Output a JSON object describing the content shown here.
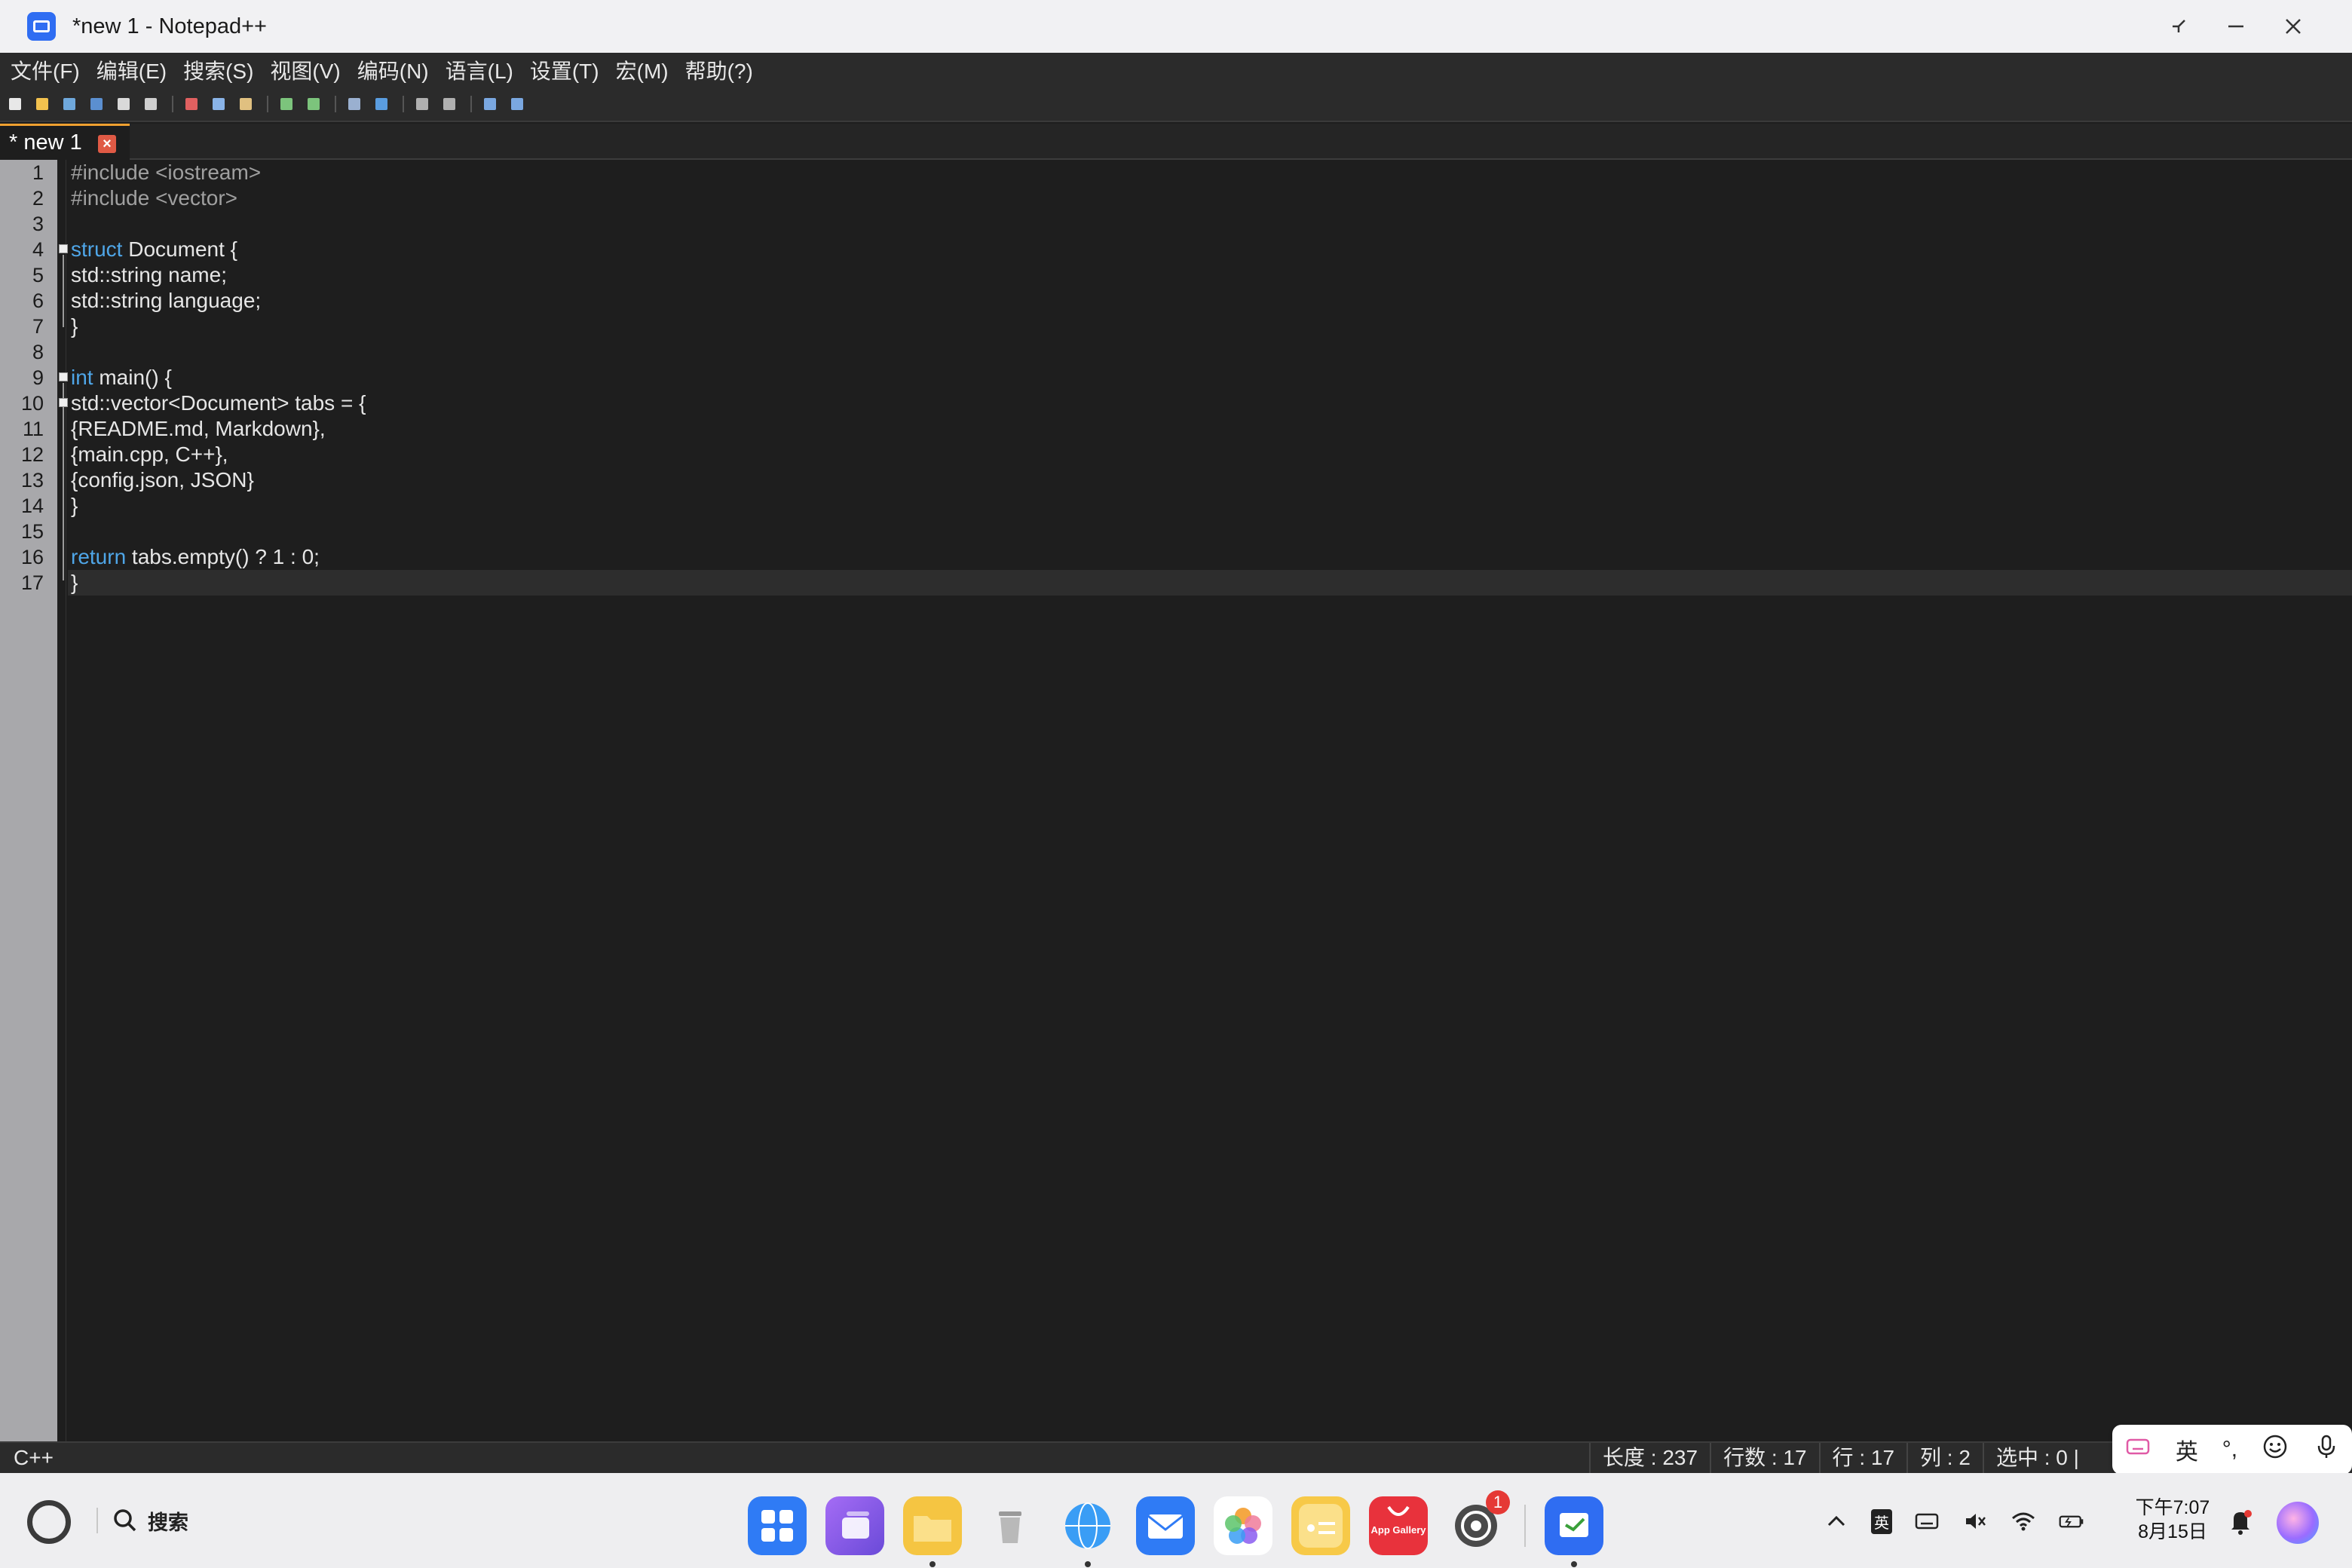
{
  "window": {
    "title": "*new 1 - Notepad++",
    "controls": [
      "restore-icon",
      "minimize-icon",
      "close-icon"
    ]
  },
  "menu": {
    "items": [
      "文件(F)",
      "编辑(E)",
      "搜索(S)",
      "视图(V)",
      "编码(N)",
      "语言(L)",
      "设置(T)",
      "宏(M)",
      "帮助(?)"
    ]
  },
  "toolbar": {
    "buttons": [
      "new-file-icon",
      "open-file-icon",
      "save-icon",
      "save-all-icon",
      "close-icon",
      "close-all-icon",
      "print-icon",
      "cut-icon",
      "copy-icon",
      "paste-icon",
      "undo-icon",
      "redo-icon",
      "find-icon",
      "replace-icon",
      "zoom-in-icon",
      "zoom-out-icon",
      "wrap-icon",
      "show-all-chars-icon"
    ]
  },
  "tabs": [
    {
      "label": "* new 1",
      "active": true
    }
  ],
  "editor": {
    "lines": [
      {
        "num": "1",
        "text": "#include <iostream>"
      },
      {
        "num": "2",
        "text": "#include <vector>"
      },
      {
        "num": "3",
        "text": ""
      },
      {
        "num": "4",
        "text": "struct Document {"
      },
      {
        "num": "5",
        "text": "std::string name;"
      },
      {
        "num": "6",
        "text": "std::string language;"
      },
      {
        "num": "7",
        "text": "}"
      },
      {
        "num": "8",
        "text": ""
      },
      {
        "num": "9",
        "text": "int main() {"
      },
      {
        "num": "10",
        "text": "std::vector<Document> tabs = {"
      },
      {
        "num": "11",
        "text": "{README.md, Markdown},"
      },
      {
        "num": "12",
        "text": "{main.cpp, C++},"
      },
      {
        "num": "13",
        "text": "{config.json, JSON}"
      },
      {
        "num": "14",
        "text": "}"
      },
      {
        "num": "15",
        "text": ""
      },
      {
        "num": "16",
        "text": "return tabs.empty() ? 1 : 0;"
      },
      {
        "num": "17",
        "text": "}"
      }
    ],
    "current_line": "17",
    "colors": {
      "keyword": "#4fa6e8",
      "preprocessor": "#a0a0a0",
      "text": "#e6e6e6",
      "background": "#1e1e1e"
    }
  },
  "status": {
    "language": "C++",
    "length": "长度 : 237",
    "lines": "行数 : 17",
    "row": "行 : 17",
    "col": "列 : 2",
    "selection": "选中 : 0 |"
  },
  "ime": {
    "items": [
      "keyboard-icon",
      "英",
      "punctuation-icon",
      "emoji-icon",
      "microphone-icon"
    ],
    "mode_label": "英"
  },
  "taskbar": {
    "search_label": "搜索",
    "apps": [
      {
        "name": "launcher-app",
        "color": "#2f7bf5",
        "running": false
      },
      {
        "name": "multitask-app",
        "color": "#8a5cf0",
        "running": false
      },
      {
        "name": "files-app",
        "color": "#f5c542",
        "running": true
      },
      {
        "name": "trash-app",
        "color": "#c9c9c9",
        "running": false
      },
      {
        "name": "browser-app",
        "color": "#3a9df5",
        "running": true
      },
      {
        "name": "mail-app",
        "color": "#2f7bf5",
        "running": false
      },
      {
        "name": "photos-app",
        "color": "#f07b9a",
        "running": false
      },
      {
        "name": "notes-app",
        "color": "#f7c948",
        "running": false
      },
      {
        "name": "app-gallery",
        "color": "#e8323c",
        "running": false
      },
      {
        "name": "settings-app",
        "color": "#555555",
        "running": false,
        "badge": "1"
      }
    ],
    "pinned_running": {
      "name": "notepadpp-app",
      "color": "#2f6df2",
      "running": true
    },
    "app_gallery_label": "App Gallery",
    "tray": {
      "ime_label": "英",
      "icons": [
        "chevron-up-icon",
        "ime-icon",
        "keyboard-icon",
        "volume-mute-icon",
        "wifi-icon",
        "battery-icon"
      ]
    },
    "clock": {
      "time": "下午7:07",
      "date": "8月15日"
    }
  }
}
